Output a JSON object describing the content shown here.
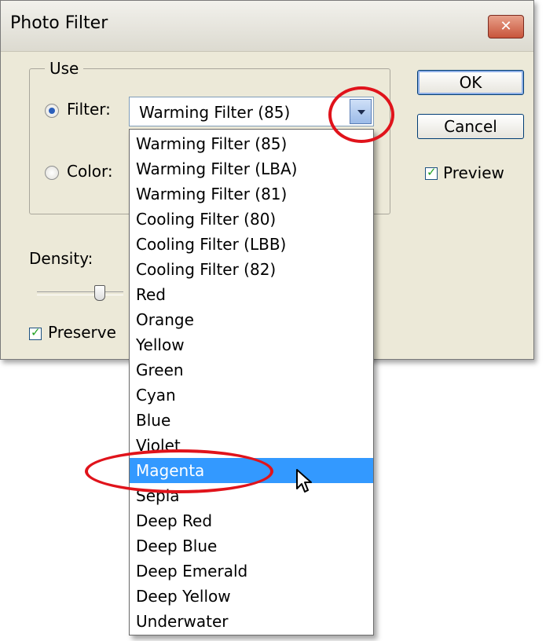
{
  "window": {
    "title": "Photo Filter",
    "close_label": "✕"
  },
  "use_group": {
    "label": "Use"
  },
  "filter": {
    "label": "Filter:",
    "selected": true,
    "value": "Warming Filter (85)"
  },
  "color": {
    "label": "Color:",
    "selected": false
  },
  "buttons": {
    "ok": "OK",
    "cancel": "Cancel"
  },
  "preview": {
    "label": "Preview",
    "checked": true
  },
  "density": {
    "label": "Density:"
  },
  "preserve": {
    "label": "Preserve",
    "checked": true
  },
  "dropdown": {
    "highlighted": "Magenta",
    "options": [
      "Warming Filter (85)",
      "Warming Filter (LBA)",
      "Warming Filter (81)",
      "Cooling Filter (80)",
      "Cooling Filter (LBB)",
      "Cooling Filter (82)",
      "Red",
      "Orange",
      "Yellow",
      "Green",
      "Cyan",
      "Blue",
      "Violet",
      "Magenta",
      "Sepia",
      "Deep Red",
      "Deep Blue",
      "Deep Emerald",
      "Deep Yellow",
      "Underwater"
    ]
  },
  "colors": {
    "selection": "#3399ff",
    "annotation": "#e0131b"
  },
  "icons": {
    "close": "close-icon",
    "dropdown_arrow": "chevron-down-icon",
    "cursor": "mouse-pointer-icon"
  }
}
